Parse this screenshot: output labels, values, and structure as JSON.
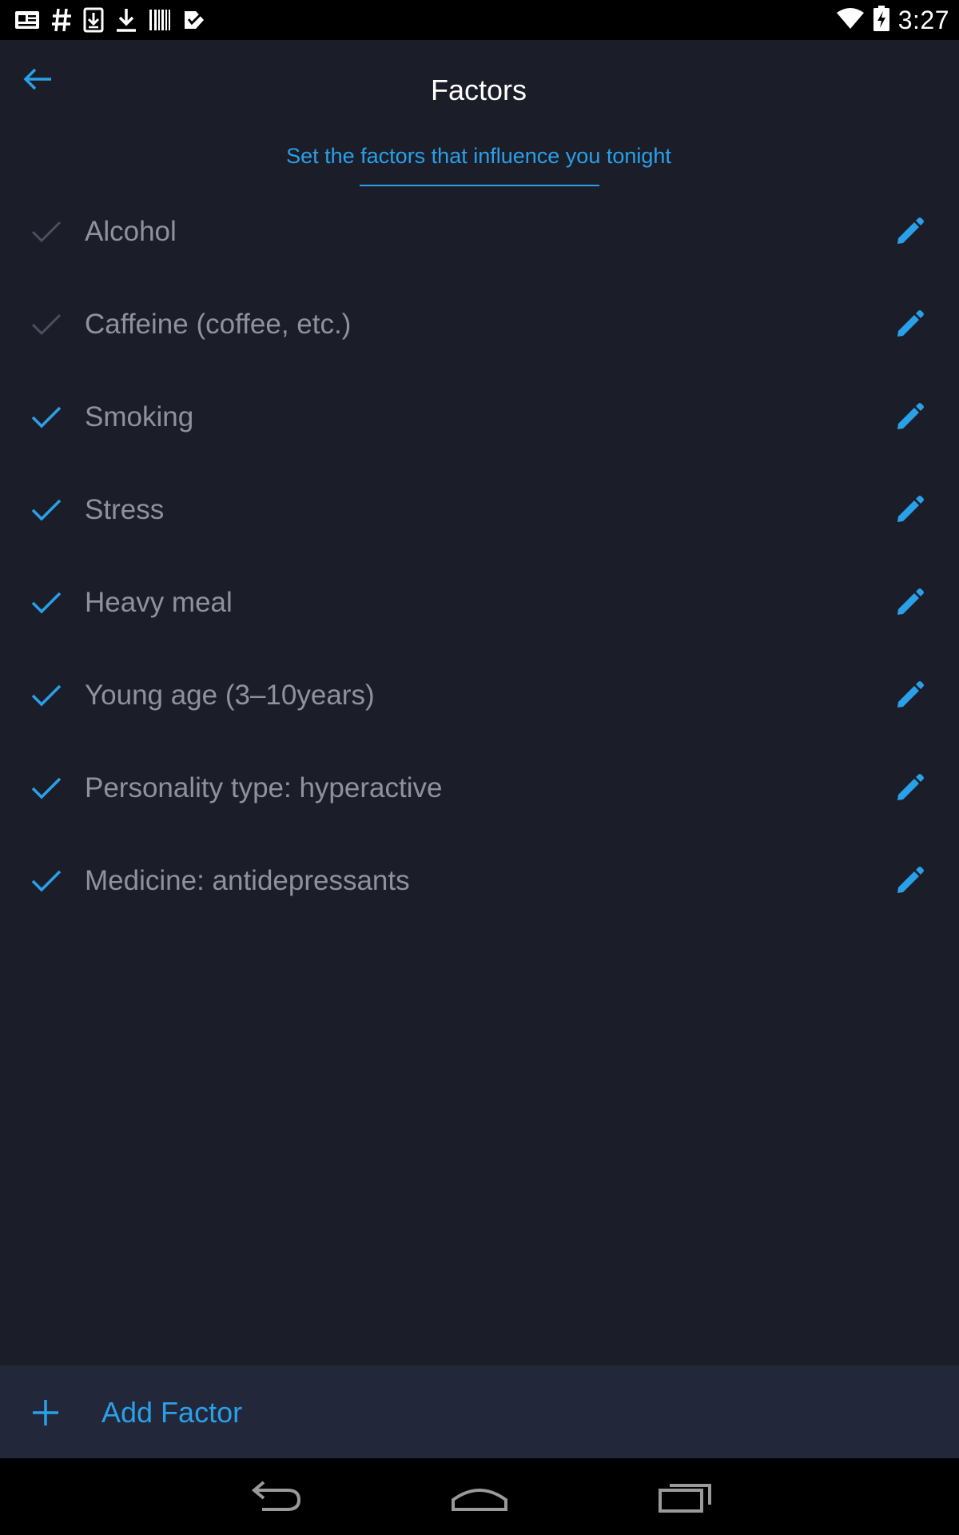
{
  "status_bar": {
    "time": "3:27",
    "left_icons": [
      "newspaper-icon",
      "hash-icon",
      "download-box-icon",
      "download-icon",
      "barcode-icon",
      "checklist-icon"
    ],
    "right_icons": [
      "wifi-icon",
      "battery-charging-icon"
    ]
  },
  "header": {
    "title": "Factors",
    "subtitle": "Set the factors that influence you tonight"
  },
  "factors": [
    {
      "label": "Alcohol",
      "checked": false
    },
    {
      "label": "Caffeine (coffee, etc.)",
      "checked": false
    },
    {
      "label": "Smoking",
      "checked": true
    },
    {
      "label": "Stress",
      "checked": true
    },
    {
      "label": "Heavy meal",
      "checked": true
    },
    {
      "label": "Young age (3–10years)",
      "checked": true
    },
    {
      "label": "Personality type: hyperactive",
      "checked": true
    },
    {
      "label": "Medicine: antidepressants",
      "checked": true
    }
  ],
  "footer": {
    "add_label": "Add Factor"
  },
  "colors": {
    "background": "#1b1e29",
    "accent": "#2aa0e8",
    "check_inactive": "#4b4f5e",
    "label_text": "#8f929a",
    "footer_bg": "#23273a"
  }
}
